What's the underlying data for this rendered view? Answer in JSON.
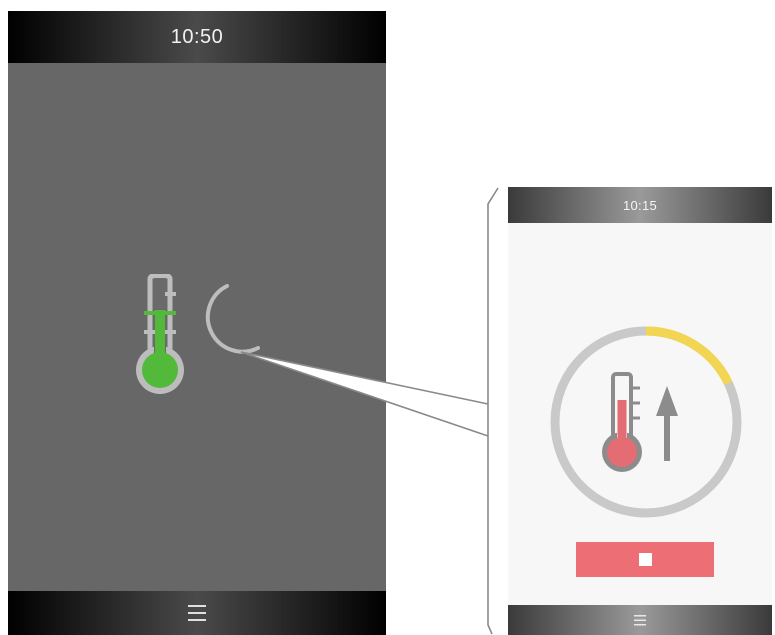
{
  "left_screen": {
    "status_bar": {
      "time": "10:50"
    },
    "status_icons": [
      "thermometer-icon",
      "moon-icon"
    ],
    "navigation": {
      "menu_icon": "hamburger-menu-icon"
    }
  },
  "right_screen": {
    "status_bar": {
      "time": "10:15"
    },
    "heating_indicator": {
      "icons": [
        "thermometer-icon",
        "arrow-up-icon"
      ],
      "progress_fraction": 0.18
    },
    "stop_button": {
      "icon": "stop-icon"
    },
    "navigation": {
      "menu_icon": "hamburger-menu-icon"
    }
  },
  "colors": {
    "left_background": "#676767",
    "right_background": "#f7f7f7",
    "active_green": "#52b93a",
    "heating_red": "#e46c73",
    "progress_yellow": "#f3d554",
    "ring_gray": "#c9c9c9",
    "stop_button": "#ee6e76"
  }
}
